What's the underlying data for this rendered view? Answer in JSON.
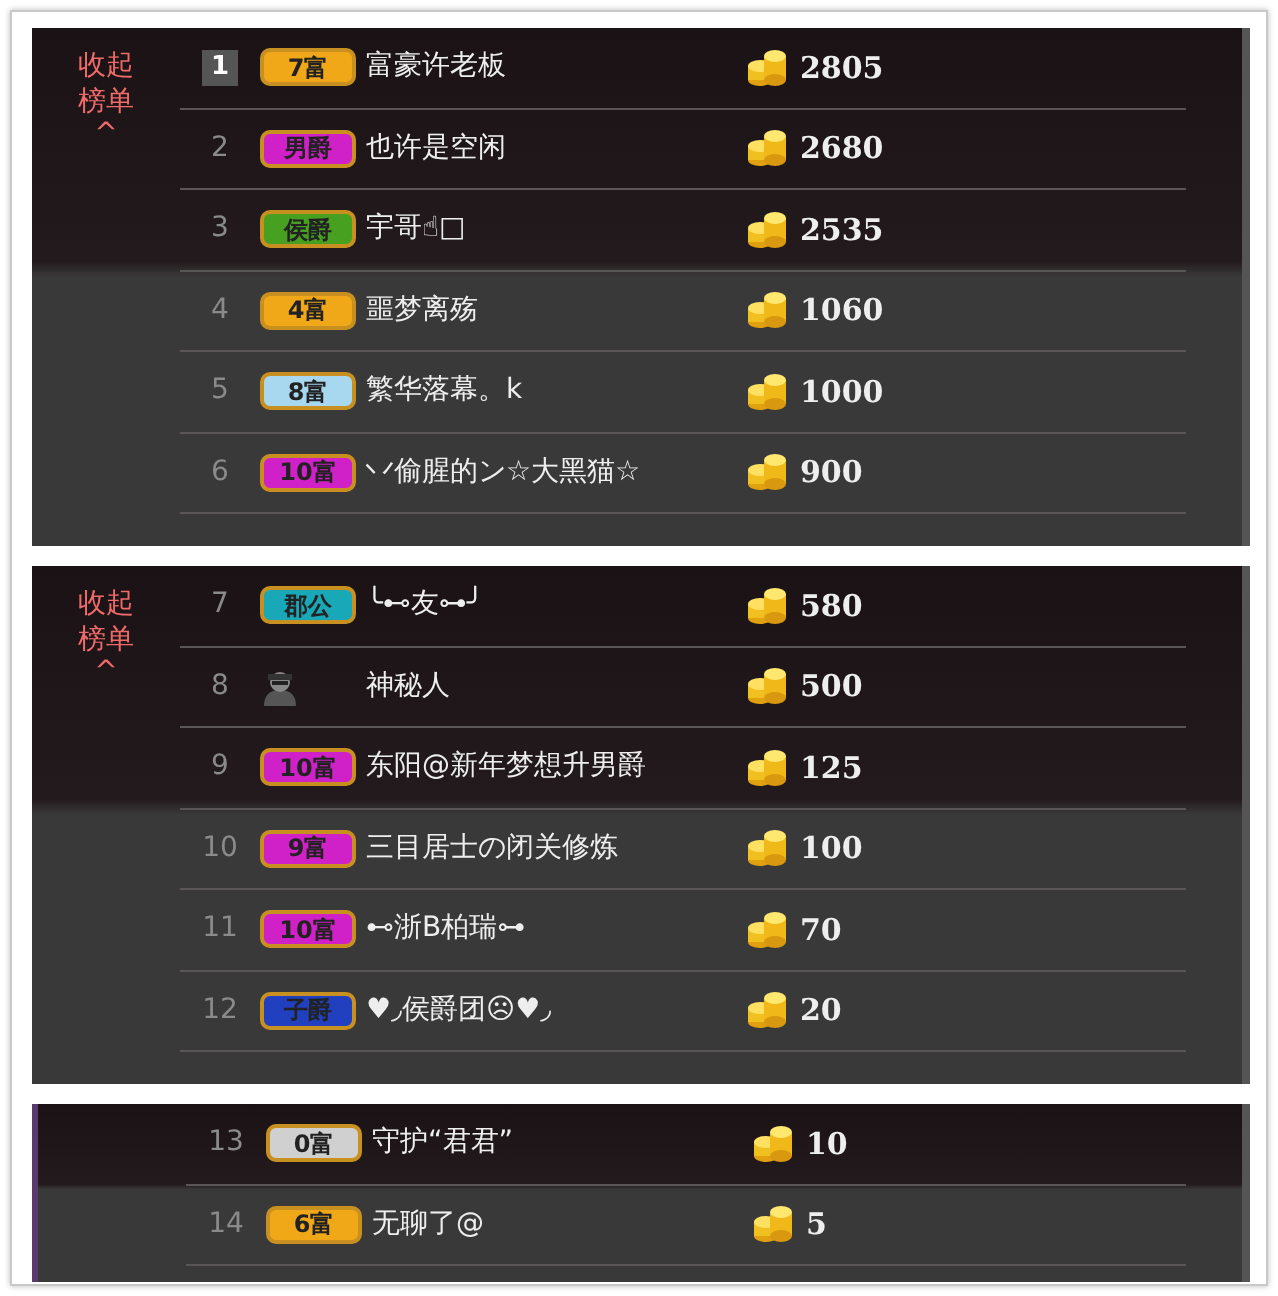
{
  "panels": [
    {
      "collapse": {
        "shown": true,
        "label": "收起榜单",
        "caret": "^"
      },
      "rows": [
        {
          "rank": "1",
          "boxed": true,
          "badge": {
            "text": "7富",
            "color": "#f0a818"
          },
          "name": "富豪许老板",
          "amount": "2805"
        },
        {
          "rank": "2",
          "boxed": false,
          "badge": {
            "text": "男爵",
            "color": "#d020c8"
          },
          "name": "也许是空闲",
          "amount": "2680"
        },
        {
          "rank": "3",
          "boxed": false,
          "badge": {
            "text": "侯爵",
            "color": "#48a020"
          },
          "name": "宇哥☝□",
          "amount": "2535"
        },
        {
          "rank": "4",
          "boxed": false,
          "badge": {
            "text": "4富",
            "color": "#f0a818"
          },
          "name": "噩梦离殇",
          "amount": "1060"
        },
        {
          "rank": "5",
          "boxed": false,
          "badge": {
            "text": "8富",
            "color": "#a8d8f0"
          },
          "name": "繁华落幕。k",
          "amount": "1000"
        },
        {
          "rank": "6",
          "boxed": false,
          "badge": {
            "text": "10富",
            "color": "#d020c8"
          },
          "name": "丷偷腥的ン☆大黑猫☆",
          "amount": "900"
        }
      ]
    },
    {
      "collapse": {
        "shown": true,
        "label": "收起榜单",
        "caret": "^"
      },
      "rows": [
        {
          "rank": "7",
          "boxed": false,
          "badge": {
            "text": "郡公",
            "color": "#18a8b8"
          },
          "name": "╰⊷友⊶╯",
          "amount": "580"
        },
        {
          "rank": "8",
          "boxed": false,
          "kind": "mystery",
          "name": "神秘人",
          "amount": "500"
        },
        {
          "rank": "9",
          "boxed": false,
          "badge": {
            "text": "10富",
            "color": "#d020c8"
          },
          "name": "东阳@新年梦想升男爵",
          "amount": "125"
        },
        {
          "rank": "10",
          "boxed": false,
          "badge": {
            "text": "9富",
            "color": "#d020c8"
          },
          "name": "三目居士の闭关修炼",
          "amount": "100"
        },
        {
          "rank": "11",
          "boxed": false,
          "badge": {
            "text": "10富",
            "color": "#d020c8"
          },
          "name": "⊷浙B柏瑞⊶",
          "amount": "70"
        },
        {
          "rank": "12",
          "boxed": false,
          "badge": {
            "text": "子爵",
            "color": "#2040c0"
          },
          "name": "♥◞侯爵团☹♥◞",
          "amount": "20"
        }
      ]
    },
    {
      "rows": [
        {
          "rank": "13",
          "boxed": false,
          "badge": {
            "text": "0富",
            "color": "#d0d0d0"
          },
          "name": "守护“君君”",
          "amount": "10"
        },
        {
          "rank": "14",
          "boxed": false,
          "badge": {
            "text": "6富",
            "color": "#f0a818"
          },
          "name": "无聊了@",
          "amount": "5"
        }
      ]
    }
  ]
}
